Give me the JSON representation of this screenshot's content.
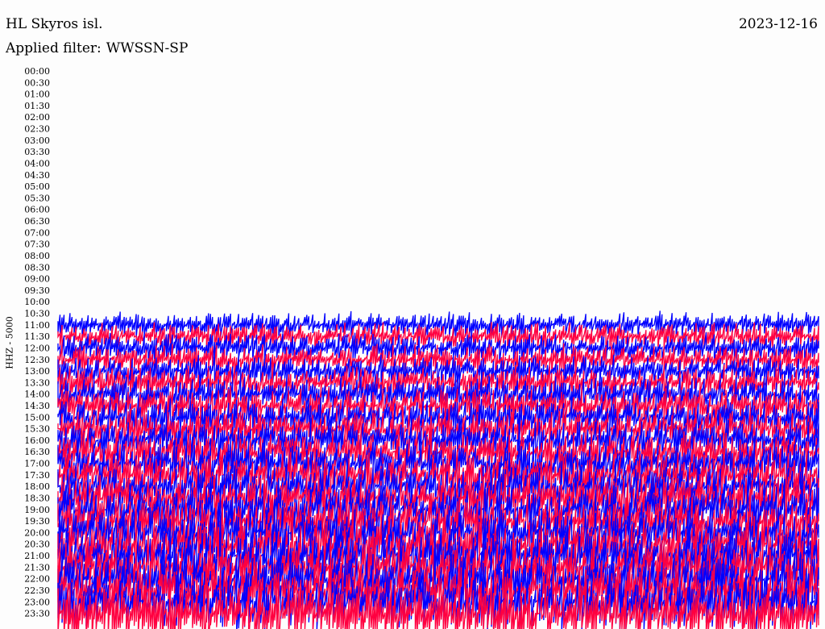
{
  "header": {
    "station": "HL Skyros isl.",
    "date": "2023-12-16",
    "filter_label": "Applied filter:",
    "filter_value": "WWSSN-SP"
  },
  "chart_data": {
    "type": "line",
    "ylabel": "HHZ - 5000",
    "time_labels": [
      "00:00",
      "00:30",
      "01:00",
      "01:30",
      "02:00",
      "02:30",
      "03:00",
      "03:30",
      "04:00",
      "04:30",
      "05:00",
      "05:30",
      "06:00",
      "06:30",
      "07:00",
      "07:30",
      "08:00",
      "08:30",
      "09:00",
      "09:30",
      "10:00",
      "10:30",
      "11:00",
      "11:30",
      "12:00",
      "12:30",
      "13:00",
      "13:30",
      "14:00",
      "14:30",
      "15:00",
      "15:30",
      "16:00",
      "16:30",
      "17:00",
      "17:30",
      "18:00",
      "18:30",
      "19:00",
      "19:30",
      "20:00",
      "20:30",
      "21:00",
      "21:30",
      "22:00",
      "22:30",
      "23:00",
      "23:30"
    ],
    "series_colors": [
      "#0000ff",
      "#ff0040"
    ],
    "data_start": "11:00",
    "grid": false
  }
}
